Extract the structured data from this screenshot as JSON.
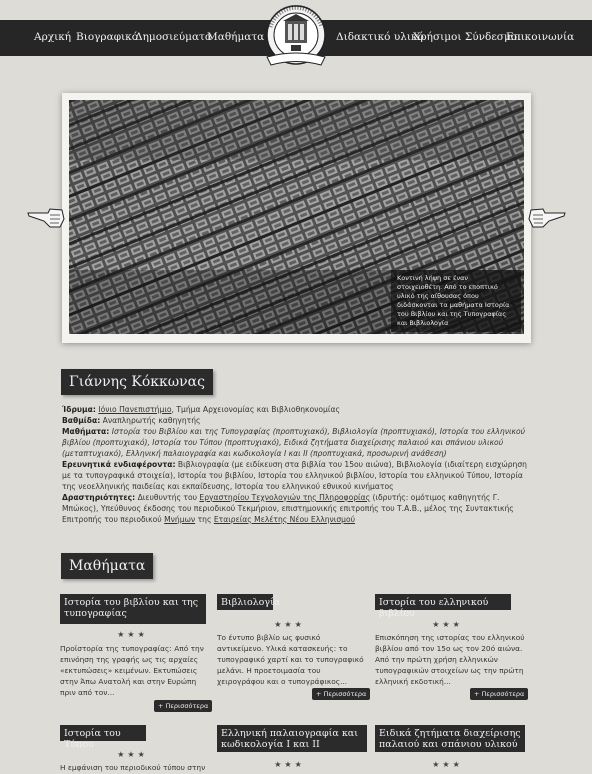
{
  "nav": {
    "items": [
      "Αρχική",
      "Βιογραφικό",
      "Δημοσιεύματα",
      "Μαθήματα",
      "Διδακτικό υλικό",
      "Χρήσιμοι Σύνδεσμοι",
      "Επικοινωνία"
    ]
  },
  "hero": {
    "caption": "Κοντινή λήψη σε έναν στοιχειοθέτη. Από το εποπτικό υλικό της αίθουσας όπου διδάσκονται τα μαθήματα Ιστορία του Βιβλίου και της Τυπογραφίας και Βιβλιολογία"
  },
  "bio": {
    "name": "Γιάννης Κόκκωνας",
    "institution_label": "Ίδρυμα:",
    "institution_link": "Ιόνιο Πανεπιστήμιο",
    "institution_rest": ", Τμήμα Αρχειονομίας και Βιβλιοθηκονομίας",
    "rank_label": "Βαθμίδα:",
    "rank_value": " Αναπληρωτής καθηγητής",
    "courses_label": "Μαθήματα:",
    "courses_value": " Ιστορία του Βιβλίου και της Τυπογραφίας (προπτυχιακό), Βιβλιολογία (προπτυχιακό), Ιστορία του ελληνικού βιβλίου (προπτυχιακό), Ιστορία του Τύπου (προπτυχιακό), Ειδικά ζητήματα διαχείρισης παλαιού και σπάνιου υλικού (μεταπτυχιακό), Ελληνική παλαιογραφία και κωδικολογία I και II (προπτυχιακά, προσωρινή ανάθεση)",
    "research_label": "Ερευνητικά ενδιαφέροντα:",
    "research_value": " Βιβλιογραφία (με ειδίκευση στα βιβλία του 15ου αιώνα), Βιβλιολογία (ιδιαίτερη εισχώρηση με τα τυπογραφικά στοιχεία), Ιστορία του βιβλίου, Ιστορία του ελληνικού βιβλίου, Ιστορία του ελληνικού Τύπου, Ιστορία της νεοελληνικής παιδείας και εκπαίδευσης, Ιστορία του ελληνικού εθνικού κινήματος",
    "activities_label": "Δραστηριότητες:",
    "activities_value_1": " Διευθυντής του ",
    "activities_link_1": "Εργαστηρίου Τεχνολογιών της Πληροφορίας",
    "activities_value_2": " (ιδρυτής: ομότιμος καθηγητής Γ. Μπώκος), Υπεύθυνος έκδοσης του περιοδικού Τεκμήριον, επιστημονικής επιτροπής του Τ.Α.Β., μέλος της Συντακτικής Επιτροπής του περιοδικού ",
    "activities_link_2": "Μνήμων",
    "activities_value_3": " της ",
    "activities_link_3": "Εταιρείας Μελέτης Νέου Ελληνισμού"
  },
  "courses": {
    "title": "Μαθήματα",
    "stars": "★★★",
    "more_label": "+ Περισσότερα",
    "items": [
      {
        "title": "Ιστορία του βιβλίου και της τυπογραφίας",
        "text": "Προϊστορία της τυπογραφίας: Από την επινόηση της γραφής ως τις αρχαίες «εκτυπώσεις» κειμένων. Εκτυπώσεις στην Άπω Ανατολή και στην Ευρώπη πριν από τον..."
      },
      {
        "title": "Βιβλιολογία",
        "text": "Το έντυπο βιβλίο ως φυσικό αντικείμενο. Υλικά κατασκευής: το τυπογραφικό χαρτί και το τυπογραφικό μελάνι. Η προετοιμασία του χειρογράφου και ο τυπογράφικος..."
      },
      {
        "title": "Ιστορία του ελληνικού βιβλίου",
        "text": "Επισκόπηση της ιστορίας του ελληνικού βιβλίου από τον 15ο ως τον 20ό αιώνα. Από την πρώτη χρήση ελληνικών τυπογραφικών στοιχείων ως την πρώτη ελληνική εκδοτική..."
      },
      {
        "title": "Ιστορία του Τύπου",
        "text": "Η εμφάνιση του περιοδικού τύπου στην"
      },
      {
        "title": "Ελληνική παλαιογραφία και κωδικολογία I και II",
        "text": ""
      },
      {
        "title": "Ειδικά ζητήματα διαχείρισης παλαιού και σπάνιου υλικού",
        "text": ""
      }
    ]
  }
}
